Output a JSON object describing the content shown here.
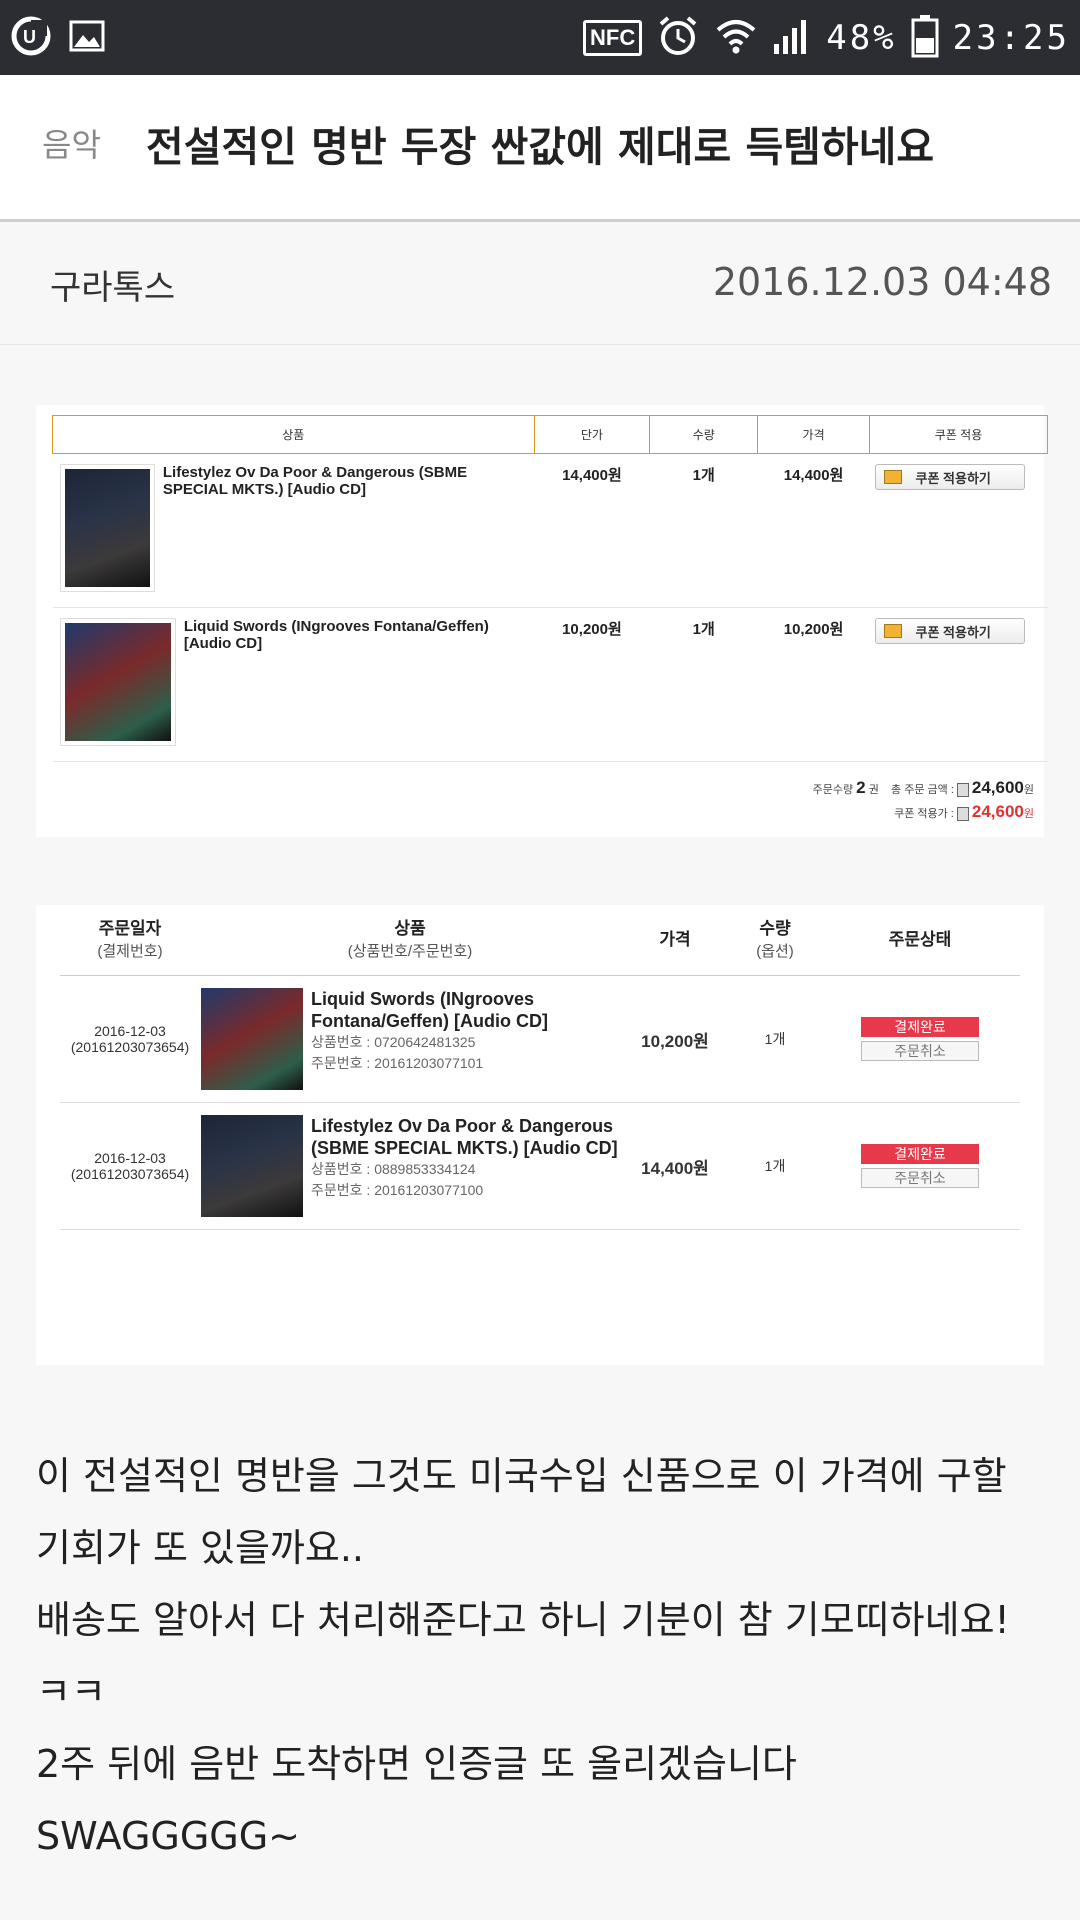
{
  "statusbar": {
    "nfc": "NFC",
    "battery": "48%",
    "time": "23:25"
  },
  "post": {
    "category": "음악",
    "title": "전설적인 명반 두장 싼값에 제대로 득템하네요",
    "author": "구라톡스",
    "datetime": "2016.12.03 04:48",
    "body": [
      "이 전설적인 명반을 그것도 미국수입 신품으로 이 가격에 구할 기회가 또 있을까요..",
      "배송도 알아서 다 처리해준다고 하니 기분이 참 기모띠하네요! ㅋㅋ",
      "2주 뒤에 음반 도착하면 인증글 또 올리겠습니다",
      "SWAGGGGG~"
    ]
  },
  "cart": {
    "headers": [
      "상품",
      "단가",
      "수량",
      "가격",
      "쿠폰 적용"
    ],
    "rows": [
      {
        "name": "Lifestylez Ov Da Poor & Dangerous (SBME SPECIAL MKTS.) [Audio CD]",
        "unit": "14,400원",
        "qty": "1개",
        "price": "14,400원",
        "coupon": "쿠폰 적용하기"
      },
      {
        "name": "Liquid Swords (INgrooves Fontana/Geffen) [Audio CD]",
        "unit": "10,200원",
        "qty": "1개",
        "price": "10,200원",
        "coupon": "쿠폰 적용하기"
      }
    ],
    "order_qty_label": "주문수량",
    "order_qty": "2",
    "order_qty_unit": "권",
    "total_label": "총 주문 금액 :",
    "total": "24,600",
    "won": "원",
    "coupon_total_label": "쿠폰 적용가 :",
    "coupon_total": "24,600"
  },
  "orders": {
    "headers": {
      "date": "주문일자",
      "date_sub": "(결제번호)",
      "product": "상품",
      "product_sub": "(상품번호/주문번호)",
      "price": "가격",
      "qty": "수량",
      "qty_sub": "(옵션)",
      "status": "주문상태"
    },
    "rows": [
      {
        "date": "2016-12-03",
        "pay_no": "(20161203073654)",
        "name": "Liquid Swords (INgrooves Fontana/Geffen) [Audio CD]",
        "prod_label": "상품번호 :",
        "prod_no": "0720642481325",
        "order_label": "주문번호 :",
        "order_no": "20161203077101",
        "price": "10,200원",
        "qty": "1개",
        "status": "결제완료",
        "cancel": "주문취소"
      },
      {
        "date": "2016-12-03",
        "pay_no": "(20161203073654)",
        "name": "Lifestylez Ov Da Poor & Dangerous (SBME SPECIAL MKTS.) [Audio CD]",
        "prod_label": "상품번호 :",
        "prod_no": "0889853334124",
        "order_label": "주문번호 :",
        "order_no": "20161203077100",
        "price": "14,400원",
        "qty": "1개",
        "status": "결제완료",
        "cancel": "주문취소"
      }
    ]
  },
  "colors": {
    "accent_red": "#e03131",
    "status_red": "#e8394a",
    "table_border": "#e2961b",
    "statusbar": "#2b2d32"
  }
}
